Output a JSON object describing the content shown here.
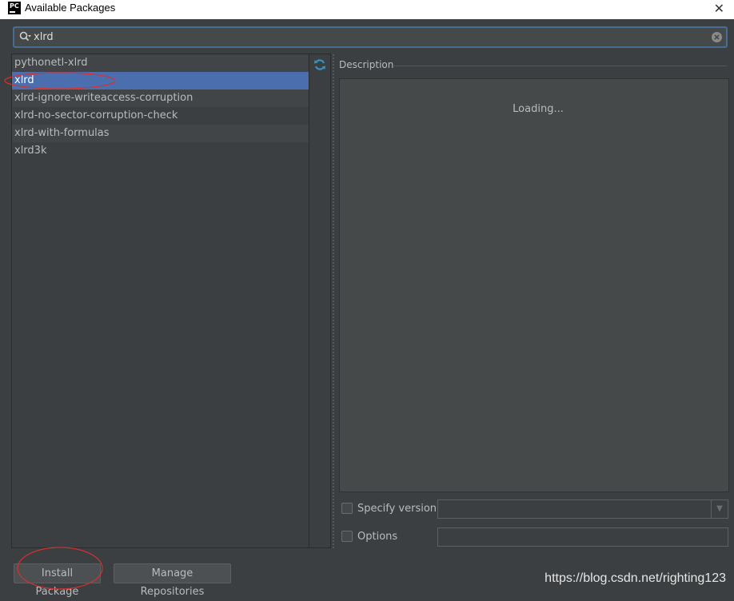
{
  "window": {
    "title": "Available Packages",
    "app_icon_text": "PC"
  },
  "search": {
    "value": "xlrd"
  },
  "packages": [
    {
      "name": "pythonetl-xlrd"
    },
    {
      "name": "xlrd"
    },
    {
      "name": "xlrd-ignore-writeaccess-corruption"
    },
    {
      "name": "xlrd-no-sector-corruption-check"
    },
    {
      "name": "xlrd-with-formulas"
    },
    {
      "name": "xlrd3k"
    }
  ],
  "selected_index": 1,
  "description": {
    "label": "Description",
    "status": "Loading..."
  },
  "options": {
    "specify_version_label": "Specify version",
    "options_label": "Options"
  },
  "buttons": {
    "install": "Install Package",
    "manage": "Manage Repositories"
  },
  "watermark": "https://blog.csdn.net/righting123",
  "colors": {
    "selection": "#4b6eaf",
    "background": "#3c3f41",
    "annotation": "#d9302e",
    "refresh": "#3592c4"
  }
}
